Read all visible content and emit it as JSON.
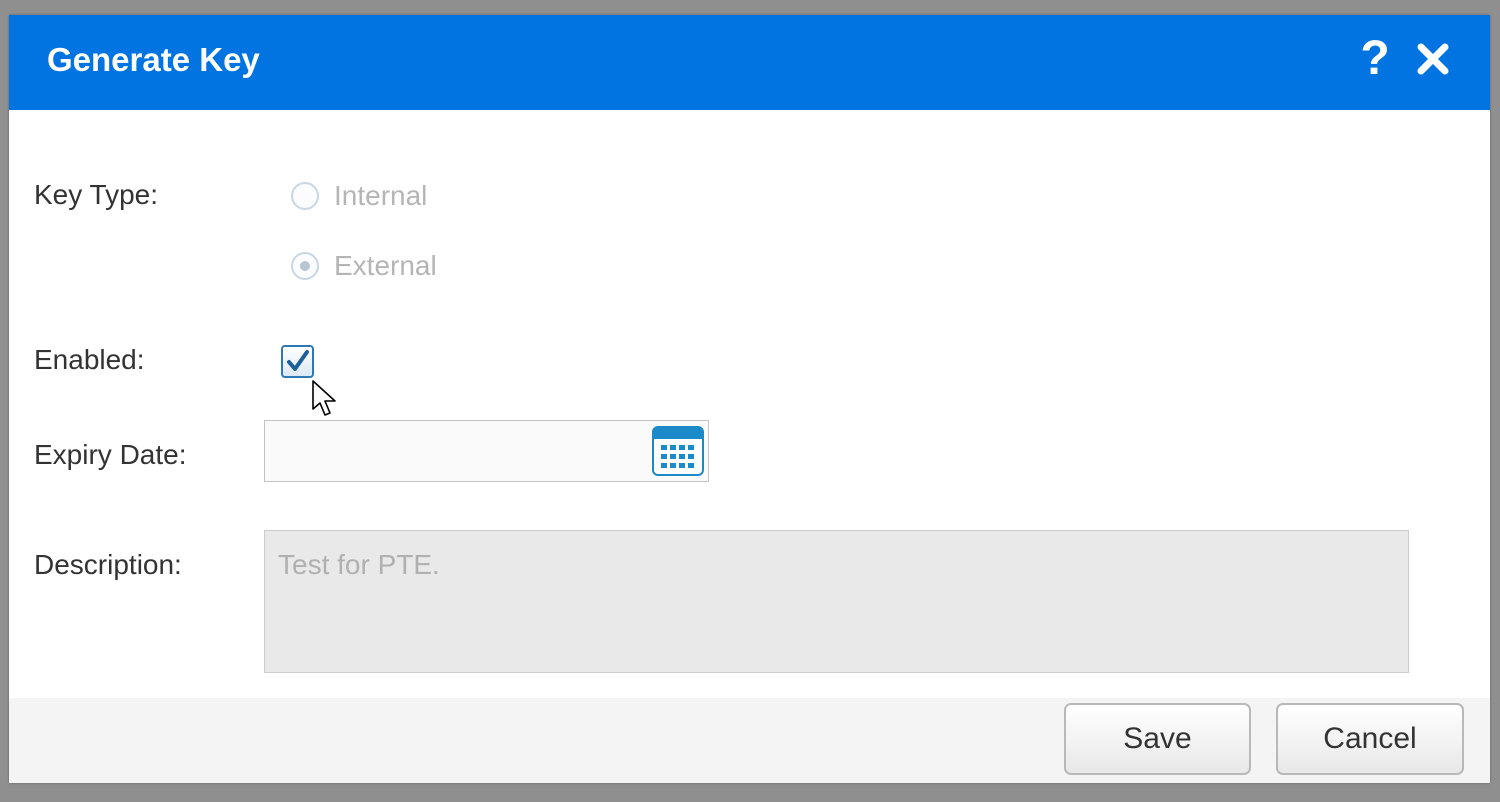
{
  "dialog": {
    "title": "Generate Key",
    "help_glyph": "?",
    "icons": {
      "help": "help-icon",
      "close": "close-icon",
      "calendar": "calendar-icon",
      "cursor": "mouse-pointer-icon"
    }
  },
  "form": {
    "key_type": {
      "label": "Key Type:",
      "options": [
        {
          "label": "Internal",
          "selected": false,
          "disabled": true
        },
        {
          "label": "External",
          "selected": true,
          "disabled": true
        }
      ]
    },
    "enabled": {
      "label": "Enabled:",
      "checked": true
    },
    "expiry_date": {
      "label": "Expiry Date:",
      "value": "",
      "placeholder": ""
    },
    "description": {
      "label": "Description:",
      "value": "Test for PTE."
    }
  },
  "footer": {
    "save_label": "Save",
    "cancel_label": "Cancel"
  },
  "colors": {
    "accent": "#0174e1",
    "checkbox_border": "#2f78b4",
    "calendar": "#1b8ac9"
  }
}
